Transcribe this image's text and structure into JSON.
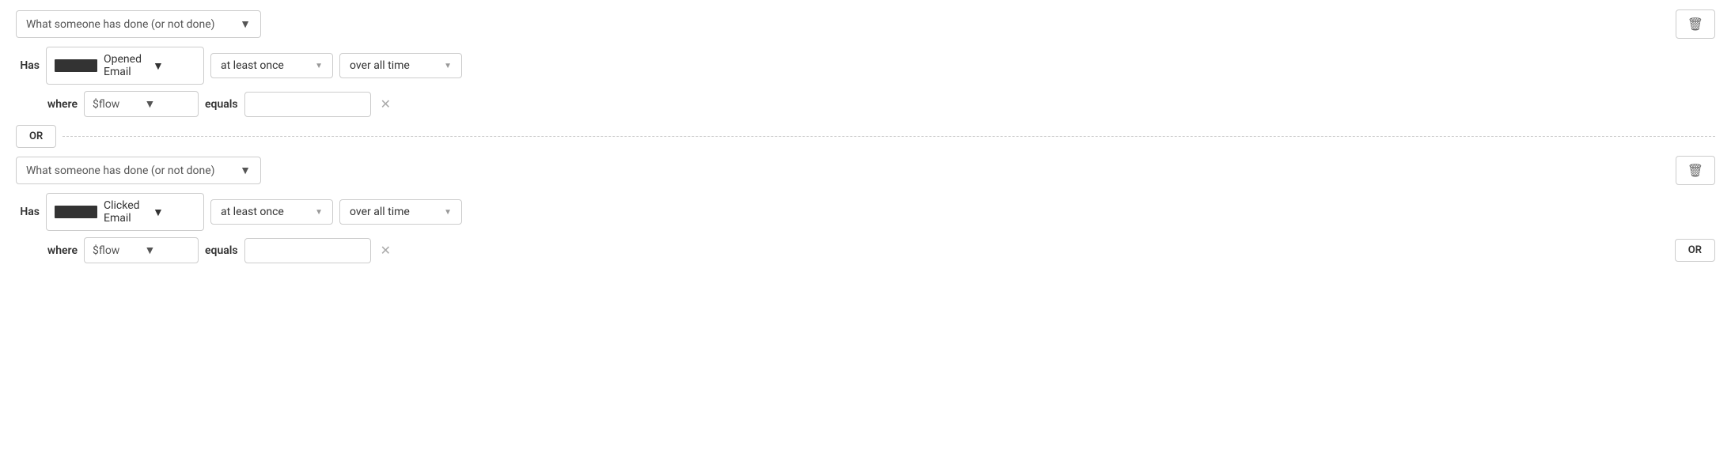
{
  "block1": {
    "what_done_label": "What someone has done (or not done)",
    "has_label": "Has",
    "event_label": "Opened Email",
    "frequency_label": "at least once",
    "time_label": "over all time",
    "where_label": "where",
    "flow_label": "$flow",
    "equals_label": "equals",
    "equals_placeholder": "",
    "trash_icon": "🗑"
  },
  "block2": {
    "what_done_label": "What someone has done (or not done)",
    "has_label": "Has",
    "event_label": "Clicked Email",
    "frequency_label": "at least once",
    "time_label": "over all time",
    "where_label": "where",
    "flow_label": "$flow",
    "equals_label": "equals",
    "equals_placeholder": "",
    "trash_icon": "🗑",
    "or_label": "OR"
  },
  "or_button_label": "OR"
}
